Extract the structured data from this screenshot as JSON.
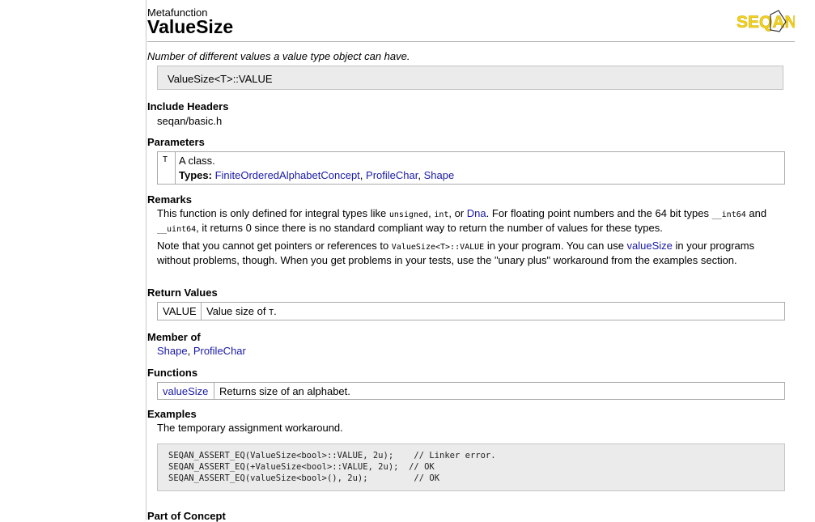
{
  "header": {
    "kind": "Metafunction",
    "title": "ValueSize",
    "logo_text": "SEQAN",
    "summary": "Number of different values a value type object can have.",
    "signature": "ValueSize<T>::VALUE"
  },
  "include": {
    "heading": "Include Headers",
    "file": "seqan/basic.h"
  },
  "parameters": {
    "heading": "Parameters",
    "name": "T",
    "description": "A class.",
    "types_label": "Types:",
    "types": [
      "FiniteOrderedAlphabetConcept",
      "ProfileChar",
      "Shape"
    ]
  },
  "remarks": {
    "heading": "Remarks",
    "p1_a": "This function is only defined for integral types like",
    "code_unsigned": "unsigned",
    "comma1": ",",
    "code_int": "int",
    "or": ", or",
    "dna_link": "Dna",
    "p1_b": ". For floating point numbers and the 64 bit types",
    "code_int64": "__int64",
    "and": "and",
    "code_uint64": "__uint64",
    "p1_c": ", it returns 0 since there is no standard compliant way to return the number of values for these types.",
    "p2_a": "Note that you cannot get pointers or references to",
    "code_valuesize": "ValueSize<T>::VALUE",
    "p2_b": "in your program. You can use",
    "valuesize_link": "valueSize",
    "p2_c": "in your programs without problems, though. When you get problems in your tests, use the \"unary plus\" workaround from the examples section."
  },
  "return_values": {
    "heading": "Return Values",
    "name": "VALUE",
    "description": "Value size of",
    "code_t": "T",
    "period": "."
  },
  "member_of": {
    "heading": "Member of",
    "links": [
      "Shape",
      "ProfileChar"
    ]
  },
  "functions": {
    "heading": "Functions",
    "name": "valueSize",
    "description": "Returns size of an alphabet."
  },
  "examples": {
    "heading": "Examples",
    "description": "The temporary assignment workaround.",
    "code_lines": [
      "SEQAN_ASSERT_EQ(ValueSize<bool>::VALUE, 2u);    // Linker error.",
      "SEQAN_ASSERT_EQ(+ValueSize<bool>::VALUE, 2u);  // OK",
      "SEQAN_ASSERT_EQ(valueSize<bool>(), 2u);         // OK"
    ]
  },
  "part_of_concept": {
    "heading": "Part of Concept"
  },
  "colors": {
    "link": "#1a1aa6",
    "logo_yellow": "#f4d21c",
    "logo_dark": "#333333",
    "box_bg": "#ebebeb"
  }
}
